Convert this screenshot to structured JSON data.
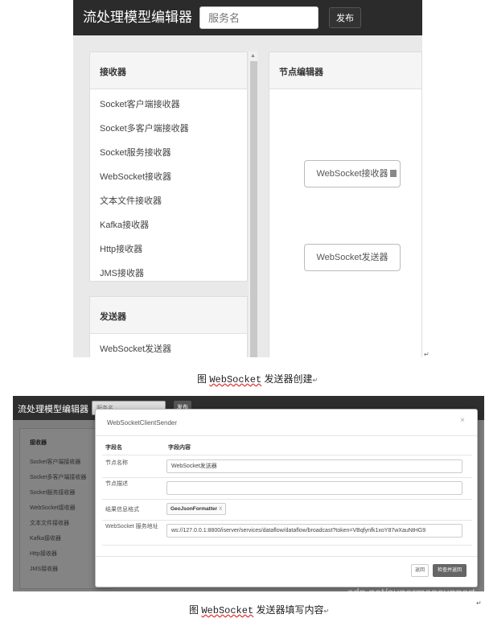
{
  "screenshot1": {
    "app_title": "流处理模型编辑器",
    "search_placeholder": "服务名",
    "publish_label": "发布",
    "receivers_panel": {
      "title": "接收器",
      "items": [
        "Socket客户端接收器",
        "Socket多客户端接收器",
        "Socket服务接收器",
        "WebSocket接收器",
        "文本文件接收器",
        "Kafka接收器",
        "Http接收器",
        "JMS接收器"
      ]
    },
    "senders_panel": {
      "title": "发送器",
      "items": [
        "WebSocket发送器"
      ]
    },
    "node_editor": {
      "title": "节点编辑器",
      "nodes": [
        "WebSocket接收器",
        "WebSocket发送器"
      ]
    }
  },
  "caption1": {
    "prefix": "图 ",
    "highlight": "WebSocket",
    "suffix": " 发送器创建"
  },
  "screenshot2": {
    "app_title": "流处理模型编辑器",
    "search_placeholder": "服务名",
    "publish_label": "发布",
    "sidebar": {
      "title": "接收器",
      "items": [
        "Socket客户端接收器",
        "Socket多客户端接收器",
        "Socket服务接收器",
        "WebSocket接收器",
        "文本文件接收器",
        "Kafka接收器",
        "Http接收器",
        "JMS接收器"
      ]
    },
    "modal": {
      "title": "WebSocketClientSender",
      "close": "×",
      "col_field": "字段名",
      "col_content": "字段内容",
      "rows": [
        {
          "label": "节点名称",
          "value": "WebSocket发送器"
        },
        {
          "label": "节点描述",
          "value": ""
        },
        {
          "label": "结果信息格式",
          "value": "GeoJsonFormatter",
          "tag_close": "X"
        },
        {
          "label": "WebSocket 服务地址",
          "value": "ws://127.0.0.1:8800/iserver/services/dataflow/dataflow/broadcast?token=VBqfynfk1xoY87wXauNtHG9"
        }
      ],
      "back_label": "返回",
      "check_label": "检查并返回"
    },
    "watermark": "sdn.net/supermapsupport"
  },
  "caption2": {
    "prefix": "图 ",
    "highlight": "WebSocket",
    "suffix": " 发送器填写内容"
  },
  "return_mark": "↵"
}
